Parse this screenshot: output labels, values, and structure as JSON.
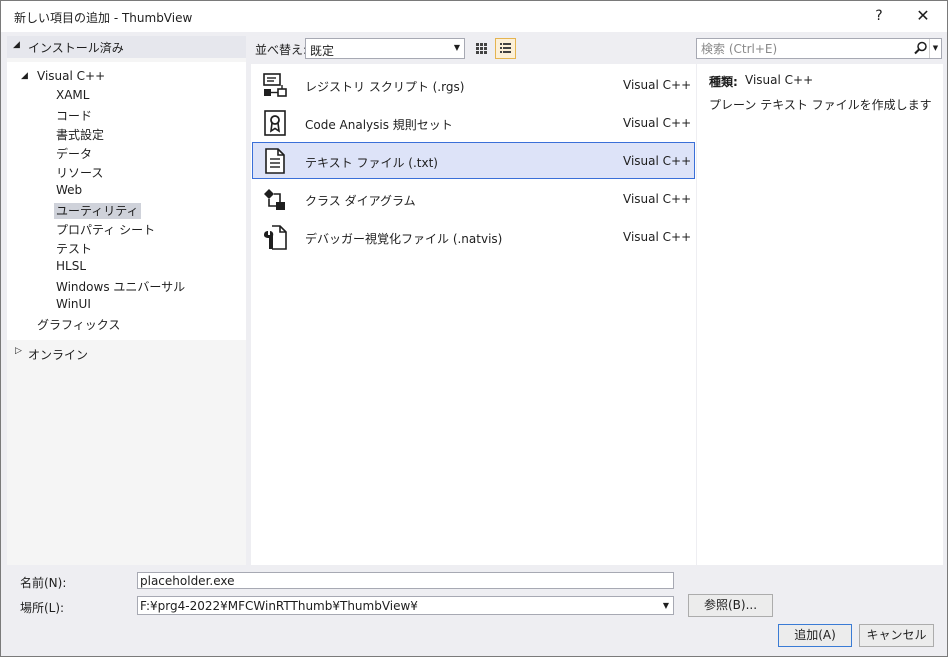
{
  "window": {
    "title": "新しい項目の追加 - ThumbView",
    "help_label": "?",
    "close_label": "✕"
  },
  "tree": {
    "installed_label": "インストール済み",
    "root": {
      "label": "Visual C++"
    },
    "children": [
      {
        "label": "XAML"
      },
      {
        "label": "コード"
      },
      {
        "label": "書式設定"
      },
      {
        "label": "データ"
      },
      {
        "label": "リソース"
      },
      {
        "label": "Web"
      },
      {
        "label": "ユーティリティ"
      },
      {
        "label": "プロパティ シート"
      },
      {
        "label": "テスト"
      },
      {
        "label": "HLSL"
      },
      {
        "label": "Windows ユニバーサル"
      },
      {
        "label": "WinUI"
      }
    ],
    "graphics_label": "グラフィックス",
    "online_label": "オンライン",
    "selected_index": 6
  },
  "toolbar": {
    "sort_label": "並べ替え:",
    "sort_value": "既定",
    "search_placeholder": "検索 (Ctrl+E)"
  },
  "templates": [
    {
      "name": "レジストリ スクリプト (.rgs)",
      "lang": "Visual C++",
      "icon": "registry-script-icon"
    },
    {
      "name": "Code Analysis 規則セット",
      "lang": "Visual C++",
      "icon": "ruleset-icon"
    },
    {
      "name": "テキスト ファイル (.txt)",
      "lang": "Visual C++",
      "icon": "text-file-icon"
    },
    {
      "name": "クラス ダイアグラム",
      "lang": "Visual C++",
      "icon": "class-diagram-icon"
    },
    {
      "name": "デバッガー視覚化ファイル (.natvis)",
      "lang": "Visual C++",
      "icon": "natvis-icon"
    }
  ],
  "selected_template_index": 2,
  "detail": {
    "type_label": "種類:",
    "type_value": "Visual C++",
    "description": "プレーン テキスト ファイルを作成します"
  },
  "form": {
    "name_label": "名前(N):",
    "name_value": "placeholder.exe",
    "location_label": "場所(L):",
    "location_value": "F:¥prg4-2022¥MFCWinRTThumb¥ThumbView¥",
    "browse_label": "参照(B)...",
    "add_label": "追加(A)",
    "cancel_label": "キャンセル"
  }
}
